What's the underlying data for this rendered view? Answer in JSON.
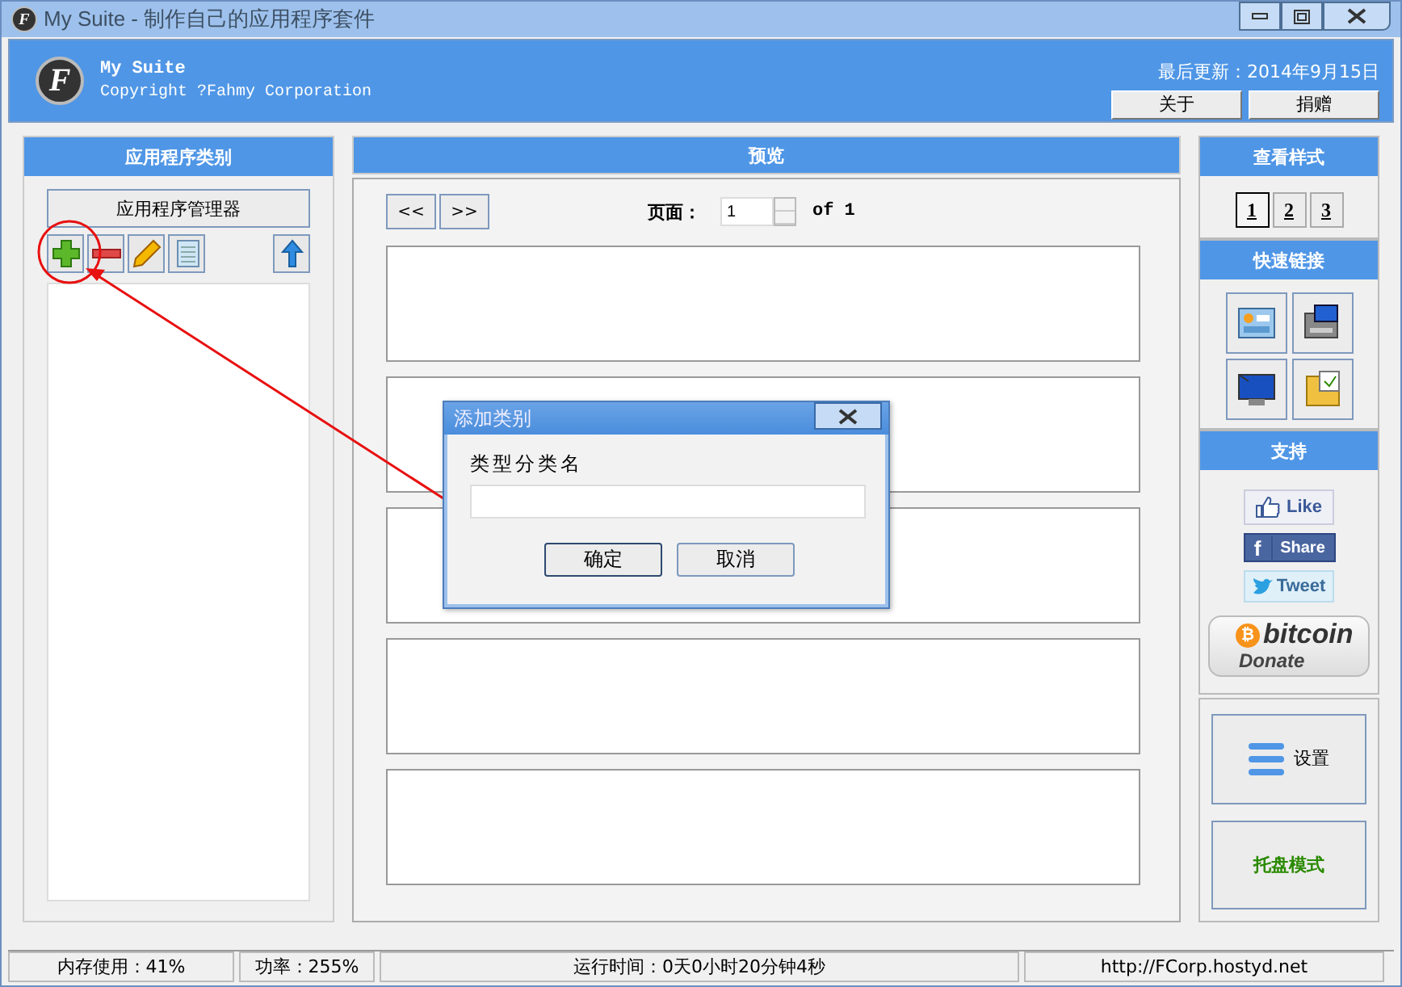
{
  "window": {
    "logo_letter": "F",
    "title": "My Suite - 制作自己的应用程序套件"
  },
  "header": {
    "app_name": "My Suite",
    "copyright": "Copyright ?Fahmy Corporation",
    "logo_letter": "F",
    "last_updated": "最后更新：2014年9月15日",
    "buttons": [
      "关于",
      "捐赠"
    ]
  },
  "categories_panel": {
    "title": "应用程序类别",
    "manager_button": "应用程序管理器"
  },
  "preview_panel": {
    "title": "预览",
    "nav_buttons": [
      "<<",
      ">>"
    ],
    "page_label": "页面：",
    "page_value": "1",
    "page_total": "of 1",
    "slots": [
      {
        "kind": "blank"
      },
      {
        "kind": "blank"
      },
      {
        "kind": "blank"
      },
      {
        "kind": "blank"
      },
      {
        "kind": "blank"
      }
    ]
  },
  "view_style": {
    "title": "查看样式",
    "options": [
      {
        "label": "1",
        "selected": true
      },
      {
        "label": "2",
        "selected": false
      },
      {
        "label": "3",
        "selected": false
      }
    ]
  },
  "quick_links": {
    "title": "快速链接"
  },
  "support": {
    "title": "支持",
    "like": "Like",
    "share_glyph": "f",
    "share": "Share",
    "tweet": "Tweet",
    "bitcoin_glyph": "₿",
    "bitcoin": "bitcoin",
    "donate": "Donate"
  },
  "settings_button": "设置",
  "tray_button": "托盘模式",
  "dialog": {
    "title": "添加类别",
    "label": "类型分类名",
    "buttons": [
      {
        "label": "确定",
        "selected": true
      },
      {
        "label": "取消",
        "selected": false
      }
    ]
  },
  "status_bar": [
    "内存使用：41%",
    "功率：255%",
    "运行时间：0天0小时20分钟4秒",
    "http://FCorp.hostyd.net"
  ]
}
